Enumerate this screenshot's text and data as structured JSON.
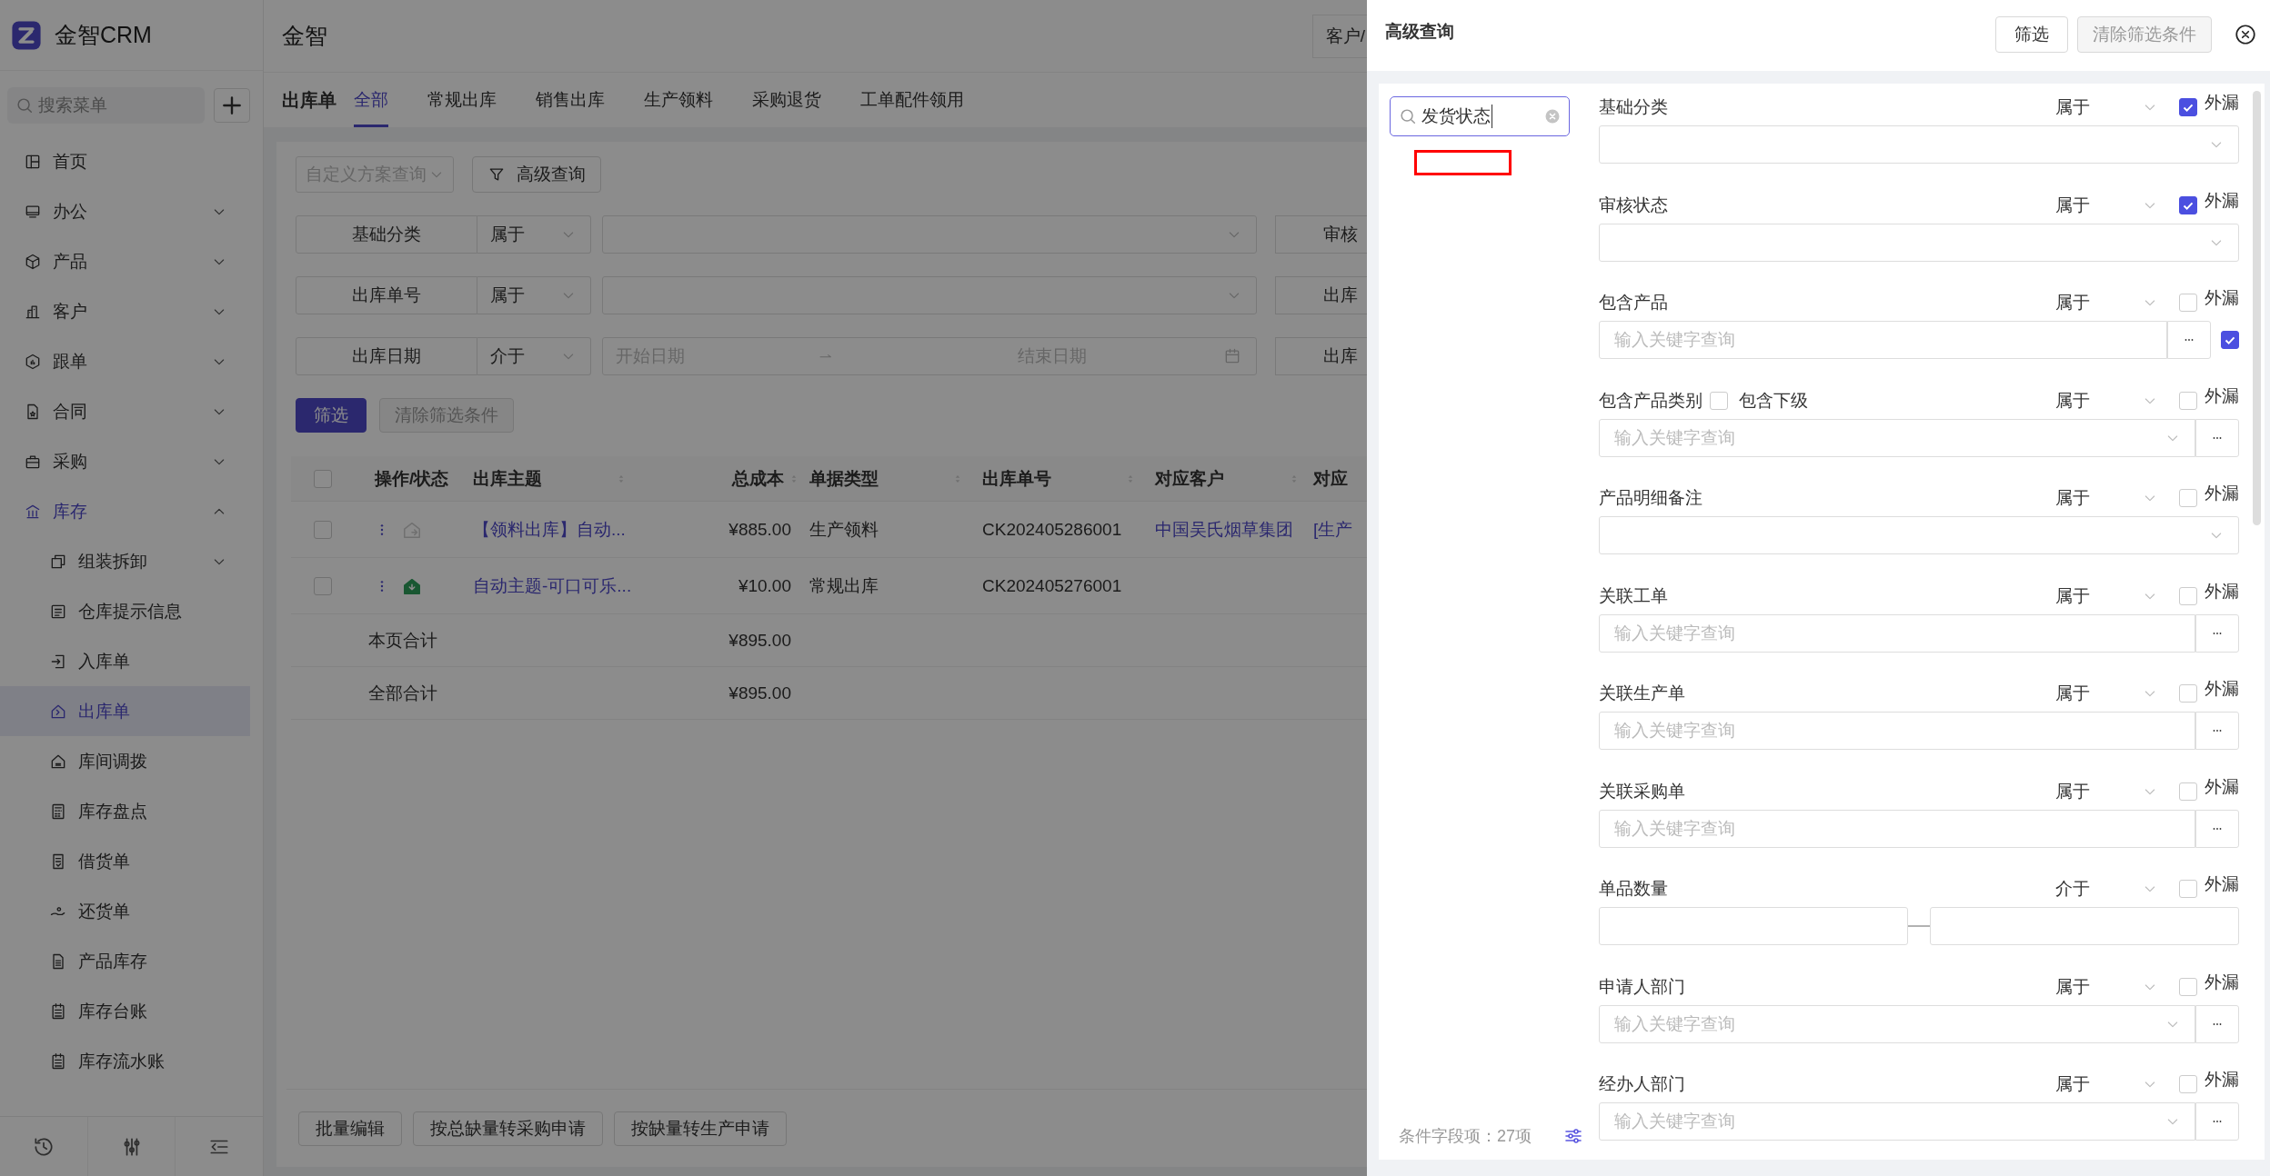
{
  "app": {
    "name": "金智CRM"
  },
  "sidebar": {
    "search": {
      "placeholder": "搜索菜单"
    },
    "items": [
      {
        "label": "首页",
        "selected": false
      },
      {
        "label": "办公",
        "selected": false,
        "expanded": false
      },
      {
        "label": "产品",
        "selected": false,
        "expanded": false
      },
      {
        "label": "客户",
        "selected": false,
        "expanded": false
      },
      {
        "label": "跟单",
        "selected": false,
        "expanded": false
      },
      {
        "label": "合同",
        "selected": false,
        "expanded": false
      },
      {
        "label": "采购",
        "selected": false,
        "expanded": false
      },
      {
        "label": "库存",
        "selected": true,
        "expanded": true,
        "children": [
          {
            "label": "组装拆卸",
            "selected": false,
            "expanded": false
          },
          {
            "label": "仓库提示信息",
            "selected": false
          },
          {
            "label": "入库单",
            "selected": false
          },
          {
            "label": "出库单",
            "selected": true
          },
          {
            "label": "库间调拨",
            "selected": false
          },
          {
            "label": "库存盘点",
            "selected": false
          },
          {
            "label": "借货单",
            "selected": false
          },
          {
            "label": "还货单",
            "selected": false
          },
          {
            "label": "产品库存",
            "selected": false
          },
          {
            "label": "库存台账",
            "selected": false
          },
          {
            "label": "库存流水账",
            "selected": false
          }
        ]
      }
    ]
  },
  "header": {
    "title": "金智",
    "right_tab": "客户/"
  },
  "page": {
    "title": "出库单",
    "tabs": [
      {
        "label": "全部",
        "selected": true
      },
      {
        "label": "常规出库",
        "selected": false
      },
      {
        "label": "销售出库",
        "selected": false
      },
      {
        "label": "生产领料",
        "selected": false
      },
      {
        "label": "采购退货",
        "selected": false
      },
      {
        "label": "工单配件领用",
        "selected": false
      }
    ]
  },
  "toolbar": {
    "scheme": {
      "placeholder": "自定义方案查询"
    },
    "advanced_button": "高级查询"
  },
  "filters": [
    {
      "kind": "select",
      "label": "基础分类",
      "operator": "属于",
      "next_label": "审核"
    },
    {
      "kind": "select",
      "label": "出库单号",
      "operator": "属于",
      "next_label": "出库"
    },
    {
      "kind": "date_range",
      "label": "出库日期",
      "operator": "介于",
      "start_placeholder": "开始日期",
      "end_placeholder": "结束日期",
      "next_label": "出库"
    }
  ],
  "filter_buttons": {
    "apply": "筛选",
    "clear": {
      "label": "清除筛选条件",
      "disabled": true
    }
  },
  "table": {
    "select_all": {
      "checked": false
    },
    "columns": [
      {
        "label": "操作/状态",
        "sortable": false
      },
      {
        "label": "出库主题",
        "sortable": true
      },
      {
        "label": "总成本",
        "sortable": true
      },
      {
        "label": "单据类型",
        "sortable": true
      },
      {
        "label": "出库单号",
        "sortable": true
      },
      {
        "label": "对应客户",
        "sortable": true
      },
      {
        "label": "对应",
        "sortable": false
      }
    ],
    "rows": [
      {
        "checked": false,
        "confirmed": false,
        "subject": "【领料出库】自动...",
        "cost": "¥885.00",
        "type": "生产领料",
        "number": "CK202405286001",
        "customer": "中国吴氏烟草集团",
        "column_8": "[生产"
      },
      {
        "checked": false,
        "confirmed": true,
        "subject": "自动主题-可口可乐...",
        "cost": "¥10.00",
        "type": "常规出库",
        "number": "CK202405276001"
      }
    ],
    "totals": [
      {
        "label": "本页合计",
        "cost": "¥895.00"
      },
      {
        "label": "全部合计",
        "cost": "¥895.00"
      }
    ]
  },
  "bottom_buttons": [
    "批量编辑",
    "按总缺量转采购申请",
    "按缺量转生产申请"
  ],
  "drawer": {
    "title": "高级查询",
    "apply": "筛选",
    "clear": {
      "label": "清除筛选条件",
      "disabled": true
    },
    "search": {
      "value": "发货状态"
    },
    "field_count": "条件字段项：27项",
    "fields": [
      {
        "kind": "select",
        "label": "基础分类",
        "operator": "属于",
        "leak": {
          "label": "外漏",
          "checked": true
        }
      },
      {
        "kind": "select",
        "label": "审核状态",
        "operator": "属于",
        "leak": {
          "label": "外漏",
          "checked": true
        }
      },
      {
        "kind": "keyword",
        "label": "包含产品",
        "operator": "属于",
        "leak": {
          "label": "外漏",
          "checked": false
        },
        "placeholder": "输入关键字查询",
        "extra_checked": true
      },
      {
        "kind": "keyword_select",
        "label": "包含产品类别",
        "operator": "属于",
        "sub_option": {
          "label": "包含下级",
          "checked": false
        },
        "leak": {
          "label": "外漏",
          "checked": false
        },
        "placeholder": "输入关键字查询"
      },
      {
        "kind": "select",
        "label": "产品明细备注",
        "operator": "属于",
        "leak": {
          "label": "外漏",
          "checked": false
        }
      },
      {
        "kind": "keyword",
        "label": "关联工单",
        "operator": "属于",
        "leak": {
          "label": "外漏",
          "checked": false
        },
        "placeholder": "输入关键字查询"
      },
      {
        "kind": "keyword",
        "label": "关联生产单",
        "operator": "属于",
        "leak": {
          "label": "外漏",
          "checked": false
        },
        "placeholder": "输入关键字查询"
      },
      {
        "kind": "keyword",
        "label": "关联采购单",
        "operator": "属于",
        "leak": {
          "label": "外漏",
          "checked": false
        },
        "placeholder": "输入关键字查询"
      },
      {
        "kind": "range",
        "label": "单品数量",
        "operator": "介于",
        "leak": {
          "label": "外漏",
          "checked": false
        }
      },
      {
        "kind": "keyword_select",
        "label": "申请人部门",
        "operator": "属于",
        "leak": {
          "label": "外漏",
          "checked": false
        },
        "placeholder": "输入关键字查询"
      },
      {
        "kind": "keyword_select",
        "label": "经办人部门",
        "operator": "属于",
        "leak": {
          "label": "外漏",
          "checked": false
        },
        "placeholder": "输入关键字查询"
      }
    ]
  }
}
